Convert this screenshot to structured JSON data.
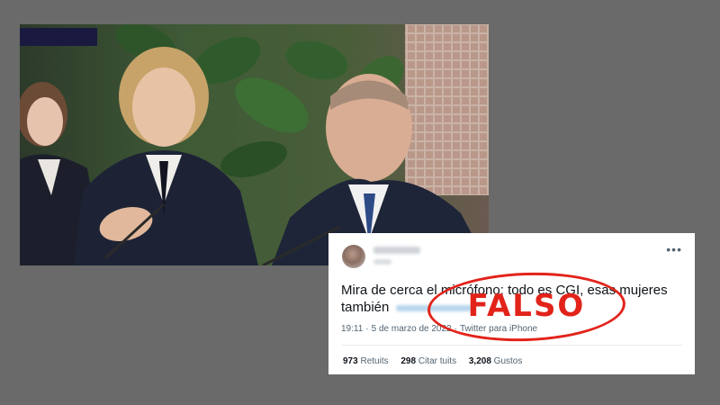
{
  "tweet": {
    "text": "Mira de cerca el micrófono: todo es CGI, esas mujeres también",
    "more_icon": "more-dots-icon",
    "time": "19:11",
    "date": "5 de marzo de 2022",
    "client": "Twitter para iPhone",
    "stats": [
      {
        "count": "973",
        "label": "Retuits"
      },
      {
        "count": "298",
        "label": "Citar tuits"
      },
      {
        "count": "3,208",
        "label": "Gustos"
      }
    ]
  },
  "stamp": {
    "label": "FALSO",
    "color": "#e2231a"
  },
  "colors": {
    "background": "#6a6a6a",
    "tweet_bg": "#ffffff",
    "stamp": "#e2231a"
  }
}
